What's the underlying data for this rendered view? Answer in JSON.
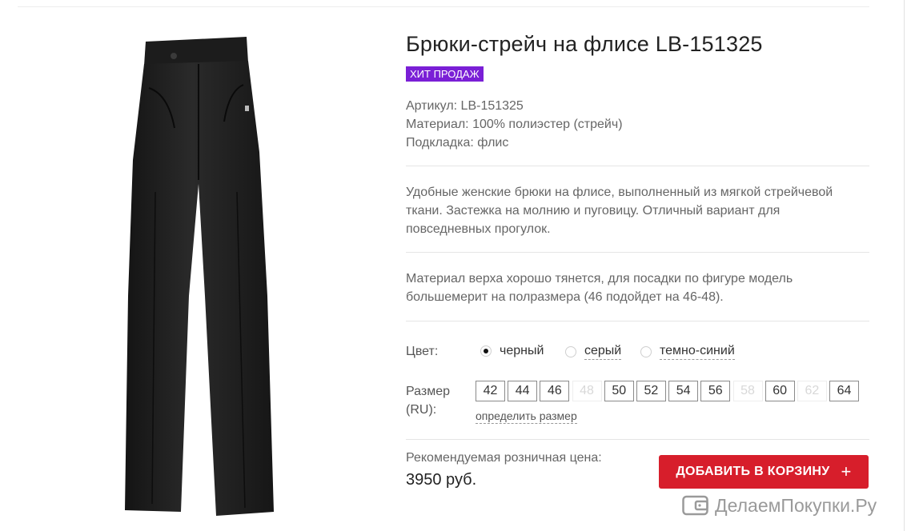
{
  "product": {
    "title": "Брюки-стрейч на флисе LB-151325",
    "badge": "ХИТ ПРОДАЖ",
    "specs": {
      "article": "Артикул: LB-151325",
      "material": "Материал: 100% полиэстер (стрейч)",
      "lining": "Подкладка: флис"
    },
    "description": "Удобные женские брюки на флисе, выполненный из мягкой стрейчевой ткани. Застежка на молнию и пуговицу. Отличный вариант для повседневных прогулок.",
    "fit_note": "Материал верха хорошо тянется, для посадки по фигуре модель большемерит на полразмера (46 подойдет на 46-48)."
  },
  "options": {
    "color_label": "Цвет:",
    "colors": [
      {
        "name": "черный",
        "selected": true
      },
      {
        "name": "серый",
        "selected": false
      },
      {
        "name": "темно-синий",
        "selected": false
      }
    ],
    "size_label_line1": "Размер",
    "size_label_line2": "(RU):",
    "sizes": [
      {
        "value": "42",
        "available": true
      },
      {
        "value": "44",
        "available": true
      },
      {
        "value": "46",
        "available": true
      },
      {
        "value": "48",
        "available": false
      },
      {
        "value": "50",
        "available": true
      },
      {
        "value": "52",
        "available": true
      },
      {
        "value": "54",
        "available": true
      },
      {
        "value": "56",
        "available": true
      },
      {
        "value": "58",
        "available": false
      },
      {
        "value": "60",
        "available": true
      },
      {
        "value": "62",
        "available": false
      },
      {
        "value": "64",
        "available": true
      }
    ],
    "size_help_link": "определить размер"
  },
  "pricing": {
    "label": "Рекомендуемая розничная цена:",
    "price": "3950 руб."
  },
  "cart_button": {
    "label": "ДОБАВИТЬ В КОРЗИНУ",
    "icon": "+"
  },
  "watermark": {
    "text": "ДелаемПокупки.Ру",
    "icon": "wallet-icon"
  },
  "colors": {
    "badge_bg": "#7a1fd6",
    "cart_button_bg": "#d71e2b",
    "text_muted": "#666666"
  }
}
